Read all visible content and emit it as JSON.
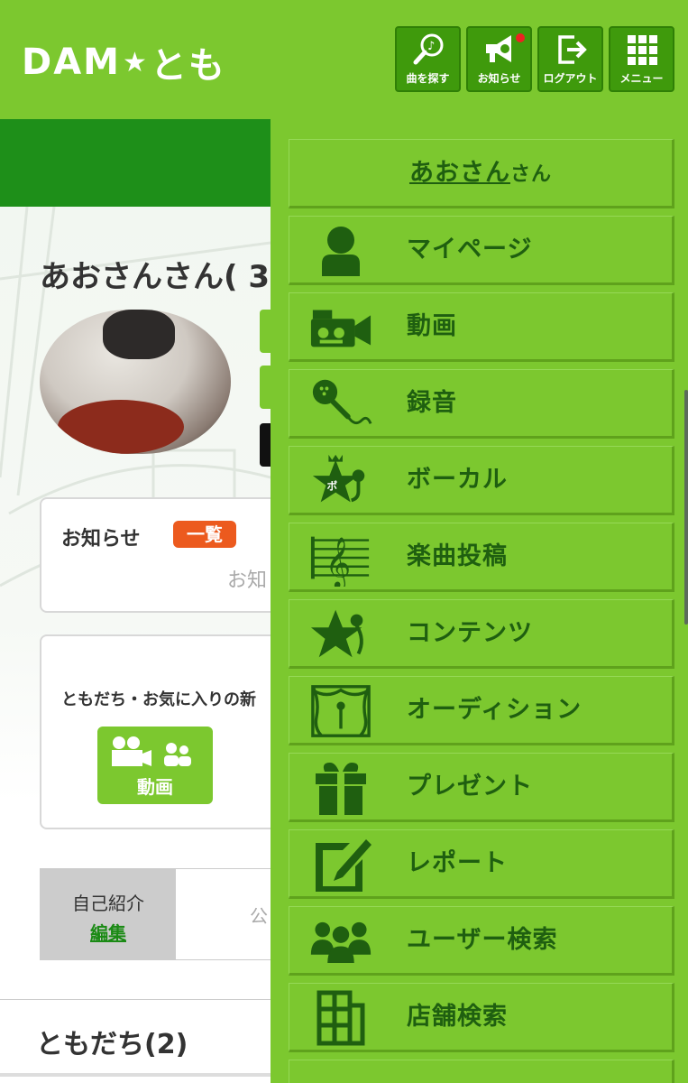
{
  "header": {
    "logo": {
      "main": "DAM",
      "star": "★",
      "suffix": "とも"
    },
    "buttons": [
      {
        "label": "曲を探す",
        "icon": "search-music-icon"
      },
      {
        "label": "お知らせ",
        "icon": "megaphone-icon",
        "has_dot": true
      },
      {
        "label": "ログアウト",
        "icon": "logout-icon"
      },
      {
        "label": "メニュー",
        "icon": "grid-menu-icon"
      }
    ]
  },
  "background_page": {
    "profile_name": "あおさんさん( 3",
    "news": {
      "title": "お知らせ",
      "badge": "一覧",
      "sub": "お知"
    },
    "activity": {
      "title": "ともだち・お気に入りの新",
      "video_label": "動画"
    },
    "intro": {
      "label": "自己紹介",
      "edit": "編集",
      "value": "公"
    },
    "friends": "ともだち(2)"
  },
  "drawer": {
    "user": {
      "name": "あおさん",
      "suffix": "さん"
    },
    "items": [
      {
        "label": "マイページ",
        "icon": "person-icon"
      },
      {
        "label": "動画",
        "icon": "video-camera-icon"
      },
      {
        "label": "録音",
        "icon": "microphone-icon"
      },
      {
        "label": "ボーカル",
        "icon": "vocal-star-icon"
      },
      {
        "label": "楽曲投稿",
        "icon": "music-score-icon"
      },
      {
        "label": "コンテンツ",
        "icon": "star-mic-icon"
      },
      {
        "label": "オーディション",
        "icon": "stage-icon"
      },
      {
        "label": "プレゼント",
        "icon": "gift-icon"
      },
      {
        "label": "レポート",
        "icon": "report-pen-icon"
      },
      {
        "label": "ユーザー検索",
        "icon": "users-icon"
      },
      {
        "label": "店舗検索",
        "icon": "building-icon"
      }
    ]
  },
  "colors": {
    "brand_green": "#7cc82f",
    "dark_green": "#1e8f19",
    "icon_green": "#1f5f10",
    "badge_orange": "#ec5a1e"
  }
}
